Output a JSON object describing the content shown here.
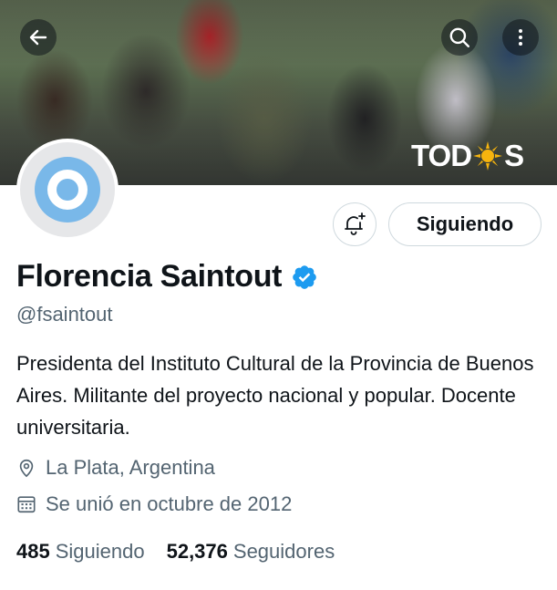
{
  "banner": {
    "brand_text_left": "TOD",
    "brand_text_right": "S"
  },
  "header": {
    "back_icon": "arrow-left-icon",
    "search_icon": "search-icon",
    "more_icon": "more-vertical-icon"
  },
  "profile": {
    "name": "Florencia Saintout",
    "handle": "@fsaintout",
    "verified": true,
    "bio": "Presidenta del Instituto Cultural de la Provincia de Buenos Aires. Militante del proyecto nacional y popular. Docente universitaria.",
    "location": "La Plata, Argentina",
    "joined": "Se unió en octubre de 2012",
    "avatar_colors": {
      "outer": "#79b8e9",
      "inner": "#ffffff",
      "ring": "#e6e7e9"
    }
  },
  "actions": {
    "follow_label": "Siguiendo",
    "notify_icon": "bell-plus-icon"
  },
  "stats": {
    "following_count": "485",
    "following_label": "Siguiendo",
    "followers_count": "52,376",
    "followers_label": "Seguidores"
  },
  "colors": {
    "text_primary": "#0f1419",
    "text_secondary": "#536471",
    "verified_blue": "#1d9bf0",
    "border": "#cfd9de"
  }
}
